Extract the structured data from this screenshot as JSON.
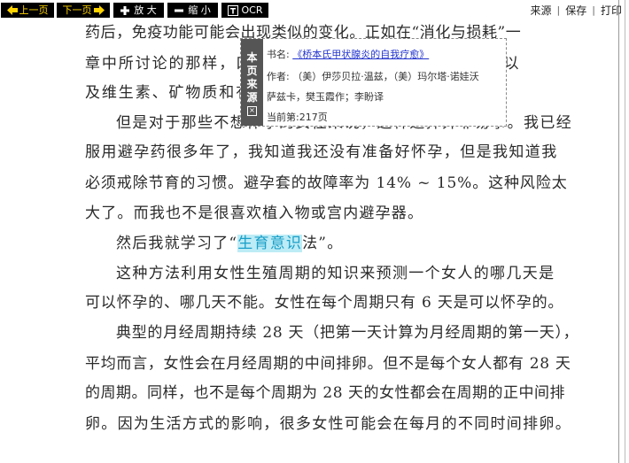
{
  "toolbar": {
    "prev_label": "上一页",
    "next_label": "下一页",
    "zoom_in_label": "放 大",
    "zoom_out_label": "缩 小",
    "ocr_label": "OCR",
    "source_label": "来源",
    "save_label": "保存",
    "print_label": "打印",
    "separator": "|"
  },
  "popup": {
    "tab_chars": [
      "本",
      "页",
      "来",
      "源"
    ],
    "close_glyph": "×",
    "book_prefix": "书名: ",
    "book_title": "《桥本氏甲状腺炎的自我疗愈》",
    "author_line1": "作者: （美）伊莎贝拉·温兹，（美）玛尔塔·诺娃沃",
    "author_line2": "萨兹卡，樊玉霞作；李盼译",
    "current_page": "当前第:217页"
  },
  "page": {
    "lines": [
      "药后，免疫功能可能会出现类似的变化。正如在“消化与损耗”一",
      "章中所讨论的那样，口服避孕药会消耗维生素，导致激素以",
      "及维生素、矿物质和有益菌的失衡。",
      "但是对于那些不想怀孕的女性来说，这种选择并非易事。我已经",
      "服用避孕药很多年了，我知道我还没有准备好怀孕，但是我知道我",
      "必须戒除节育的习惯。避孕套的故障率为 14% ~ 15%。这种风险太",
      "大了。而我也不是很喜欢植入物或宫内避孕器。",
      "然后我就学习了“",
      "生育意识",
      "法”。",
      "这种方法利用女性生殖周期的知识来预测一个女人的哪几天是",
      "可以怀孕的、哪几天不能。女性在每个周期只有 6 天是可以怀孕的。",
      "典型的月经周期持续 28 天（把第一天计算为月经周期的第一天），",
      "平均而言，女性会在月经周期的中间排卵。但不是每个女人都有 28 天",
      "的周期。同样，也不是每个周期为 28 天的女性都会在周期的正中间排",
      "卵。因为生活方式的影响，很多女性可能会在每月的不同时间排卵。"
    ]
  },
  "colors": {
    "toolbar_bg": "#000000",
    "toolbar_text": "#ffd400",
    "highlight_bg": "#bdecf6",
    "highlight_text": "#1a9fc8",
    "link": "#2233cc",
    "popup_tab_bg": "#555555"
  },
  "icons": {
    "prev": "left-arrow-icon",
    "next": "right-arrow-icon",
    "zoom_in": "plus-icon",
    "zoom_out": "minus-icon",
    "ocr": "text-t-icon"
  }
}
